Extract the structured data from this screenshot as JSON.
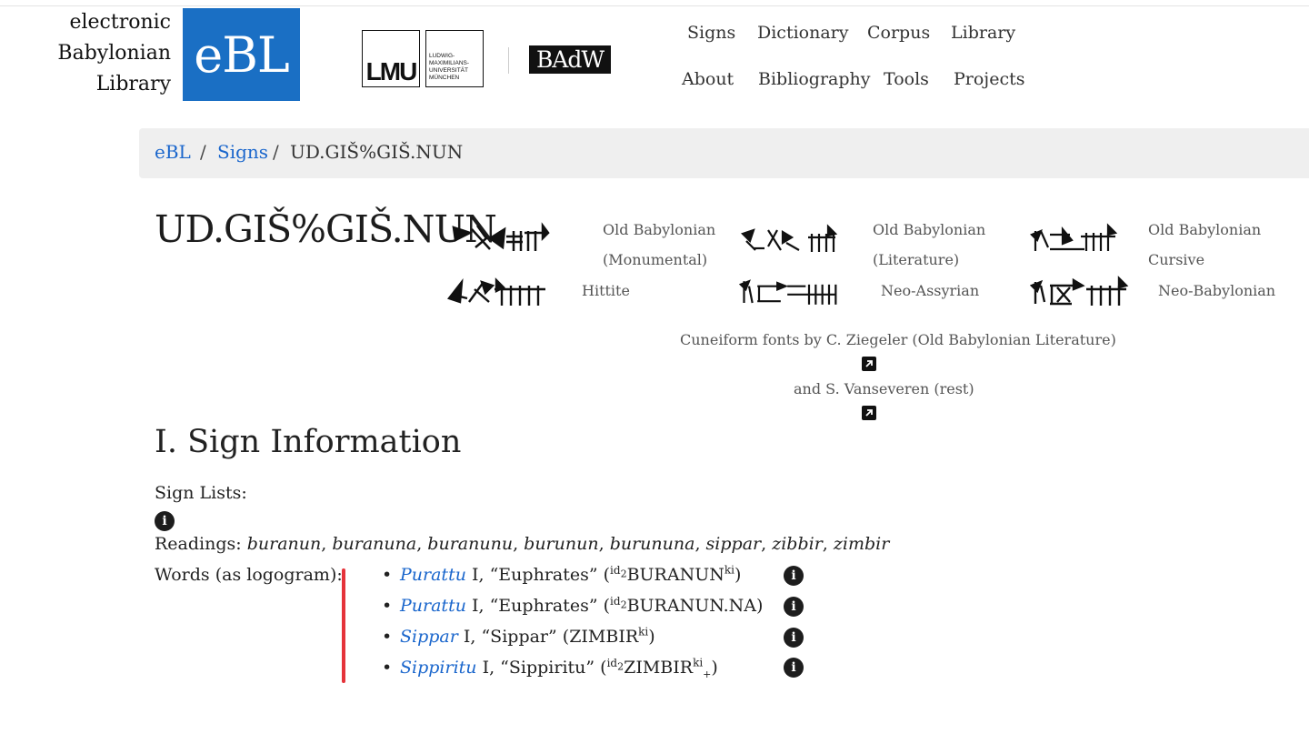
{
  "logo": {
    "line1": "electronic",
    "line2": "Babylonian",
    "line3": "Library",
    "mark": "eBL"
  },
  "partners": {
    "lmu_mark": "LMU",
    "lmu_text": "LUDWIG-\nMAXIMILIANS-\nUNIVERSITÄT\nMÜNCHEN",
    "badw": "BAdW"
  },
  "nav": {
    "signs": "Signs",
    "dictionary": "Dictionary",
    "corpus": "Corpus",
    "library": "Library",
    "about": "About",
    "bibliography": "Bibliography",
    "tools": "Tools",
    "projects": "Projects"
  },
  "breadcrumb": {
    "root": "eBL",
    "section": "Signs",
    "current": "UD.GIŠ%GIŠ.NUN",
    "separator": "/"
  },
  "sign": {
    "title": "UD.GIŠ%GIŠ.NUN"
  },
  "fonts": [
    {
      "label_line1": "Old Babylonian",
      "label_line2": "(Monumental)"
    },
    {
      "label_line1": "Old Babylonian",
      "label_line2": "(Literature)"
    },
    {
      "label_line1": "Old Babylonian",
      "label_line2": "Cursive"
    },
    {
      "label_line1": "Hittite"
    },
    {
      "label_line1": "Neo-Assyrian"
    },
    {
      "label_line1": "Neo-Babylonian"
    }
  ],
  "credits": {
    "line1": "Cuneiform fonts by C. Ziegeler (Old Babylonian Literature)",
    "line2": "and S. Vanseveren (rest)",
    "link_icon": "external-link-icon"
  },
  "info": {
    "section_title": "I. Sign Information",
    "sign_lists_label": "Sign Lists:",
    "readings_label": "Readings:",
    "readings": [
      "buranun",
      "buranuna",
      "buranunu",
      "burunun",
      "burununa",
      "sippar",
      "zibbir",
      "zimbir"
    ],
    "readings_separator": ", ",
    "words_label": "Words (as logogram):",
    "info_icon": "info-icon",
    "accent_bar_color": "#e5333a",
    "link_color": "#1a66cc"
  },
  "words": [
    {
      "lemma": "Purattu",
      "homonym": "I,",
      "gloss": "“Euphrates”",
      "open": "(",
      "det": "id",
      "det_sub": "2",
      "logogram": "BURANUN",
      "sup": "ki",
      "suffix": "",
      "close": ")"
    },
    {
      "lemma": "Purattu",
      "homonym": "I,",
      "gloss": "“Euphrates”",
      "open": "(",
      "det": "id",
      "det_sub": "2",
      "logogram": "BURANUN.NA",
      "sup": "",
      "suffix": "",
      "close": ")"
    },
    {
      "lemma": "Sippar",
      "homonym": "I,",
      "gloss": "“Sippar”",
      "open": "(",
      "det": "",
      "det_sub": "",
      "logogram": "ZIMBIR",
      "sup": "ki",
      "suffix": "",
      "close": ")"
    },
    {
      "lemma": "Sippiritu",
      "homonym": "I,",
      "gloss": "“Sippiritu”",
      "open": "(",
      "det": "id",
      "det_sub": "2",
      "logogram": "ZIMBIR",
      "sup": "ki",
      "suffix": "+",
      "close": ")"
    }
  ]
}
